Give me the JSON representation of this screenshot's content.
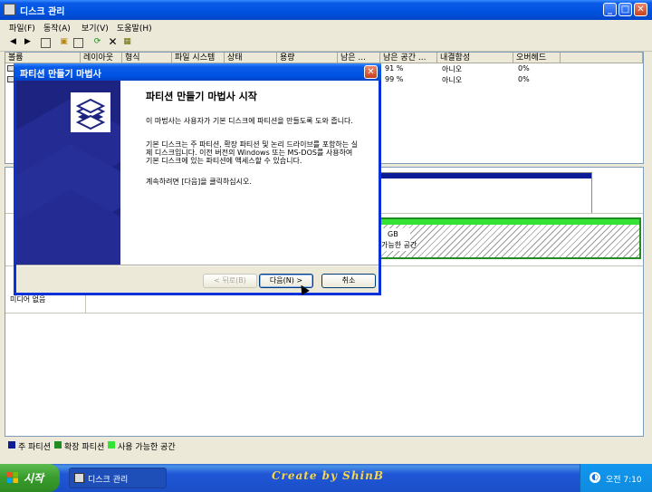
{
  "window": {
    "title": "디스크 관리"
  },
  "menu": [
    "파일(F)",
    "동작(A)",
    "보기(V)",
    "도움말(H)"
  ],
  "toolbar_icons": [
    "back-icon",
    "forward-icon",
    "list-icon",
    "properties-icon",
    "help-icon",
    "refresh-icon",
    "delete-icon",
    "settings-icon"
  ],
  "list": {
    "columns": [
      "볼륨",
      "레이아웃",
      "형식",
      "파일 시스템",
      "상태",
      "용량",
      "남은 ...",
      "남은 공간 ...",
      "내결함성",
      "오버헤드"
    ],
    "rows": [
      {
        "free_pct": "91 %",
        "fault": "아니오",
        "overhead": "0%"
      },
      {
        "free_pct": "99 %",
        "fault": "아니오",
        "overhead": "0%"
      }
    ]
  },
  "disk": {
    "partial_size": "GB",
    "partial_label": "가능한 공간",
    "media": "미디어 없음"
  },
  "legend": [
    {
      "label": "주 파티션",
      "color": "#0a1d96"
    },
    {
      "label": "확장 파티션",
      "color": "#228b22"
    },
    {
      "label": "사용 가능한 공간",
      "color": "#35e335"
    }
  ],
  "wizard": {
    "title": "파티션 만들기 마법사",
    "heading": "파티션 만들기 마법사 시작",
    "paragraph1": "이 마법사는 사용자가 기본 디스크에 파티션을 만들도록 도와 줍니다.",
    "paragraph2": "기본 디스크는 주 파티션, 확장 파티션 및 논리 드라이브를 포함하는 실제 디스크입니다. 이전 버전의 Windows 또는 MS-DOS를 사용하여 기본 디스크에 있는 파티션에 액세스할 수 있습니다.",
    "paragraph3": "계속하려면 [다음]을 클릭하십시오.",
    "back": "< 뒤로(B)",
    "next": "다음(N) >",
    "cancel": "취소"
  },
  "taskbar": {
    "start": "시작",
    "task": "디스크 관리",
    "caption": "Create by ShinB",
    "time": "오전 7:10"
  }
}
